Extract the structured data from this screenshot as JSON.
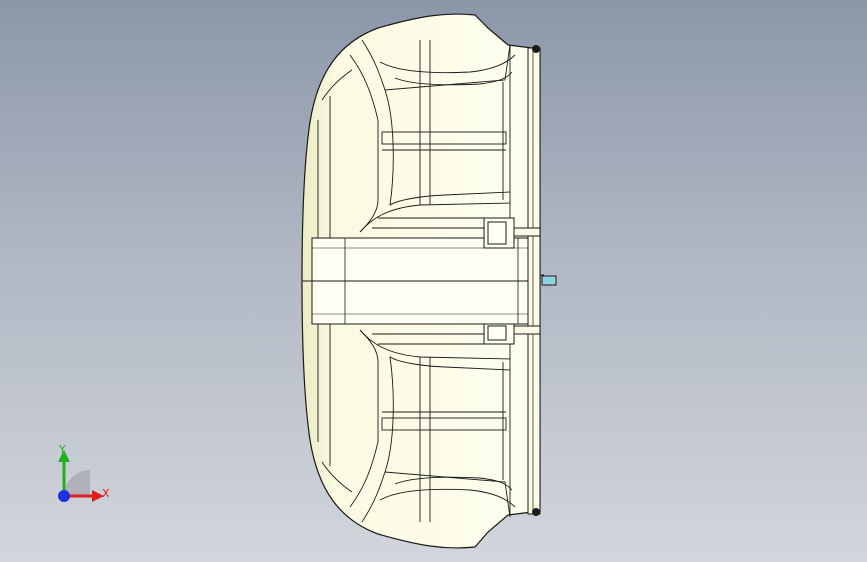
{
  "viewport": {
    "background_top": "#8b97a9",
    "background_bottom": "#d2d6dc",
    "model_fill": "#fdfde8",
    "model_shade": "#e8e6c0",
    "edge_color": "#1a1a1a",
    "accent_color": "#8fd3e0"
  },
  "triad": {
    "x_label": "X",
    "y_label": "Y",
    "x_color": "#e02020",
    "y_color": "#20b020",
    "z_color": "#2030e0"
  }
}
